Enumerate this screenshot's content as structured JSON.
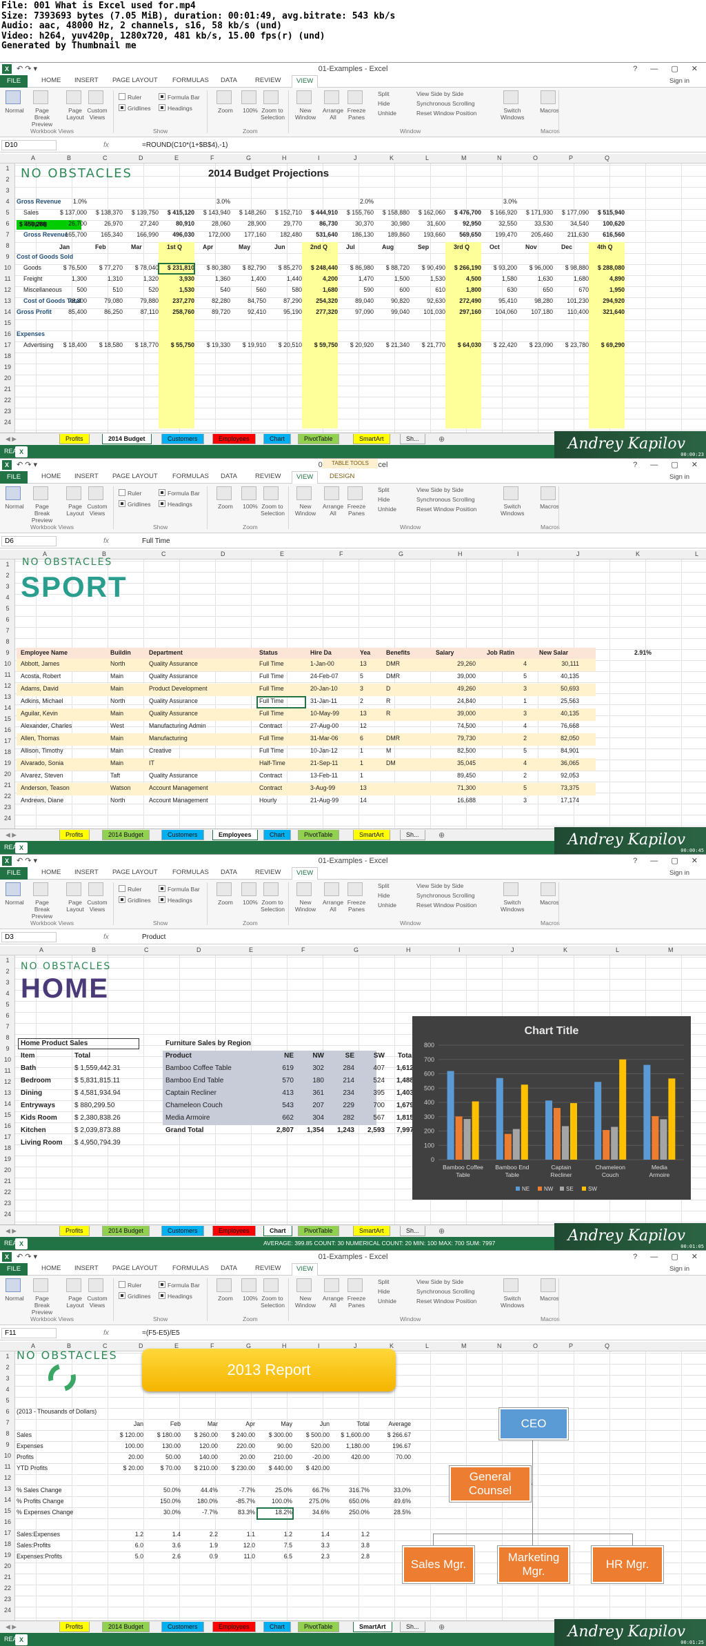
{
  "info": {
    "file": "File: 001 What is Excel used for.mp4",
    "size": "Size: 7393693 bytes (7.05 MiB), duration: 00:01:49, avg.bitrate: 543 kb/s",
    "audio": "Audio: aac, 48000 Hz, 2 channels, s16, 58 kb/s (und)",
    "video": "Video: h264, yuv420p, 1280x720, 481 kb/s, 15.00 fps(r) (und)",
    "gen": "Generated by Thumbnail me"
  },
  "common": {
    "title": "01-Examples - Excel",
    "file_tab": "FILE",
    "tabs": [
      "HOME",
      "INSERT",
      "PAGE LAYOUT",
      "FORMULAS",
      "DATA",
      "REVIEW",
      "VIEW"
    ],
    "design_tab": "DESIGN",
    "table_tools": "TABLE TOOLS",
    "sign_in": "Sign in",
    "ribbon": {
      "normal": "Normal",
      "page_break": "Page Break Preview",
      "page_layout": "Page Layout",
      "custom_views": "Custom Views",
      "ruler": "Ruler",
      "formula_bar": "Formula Bar",
      "gridlines": "Gridlines",
      "headings": "Headings",
      "zoom": "Zoom",
      "hundred": "100%",
      "zoom_sel": "Zoom to Selection",
      "new_window": "New Window",
      "arrange_all": "Arrange All",
      "freeze": "Freeze Panes",
      "split": "Split",
      "hide": "Hide",
      "unhide": "Unhide",
      "side_by_side": "View Side by Side",
      "sync_scroll": "Synchronous Scrolling",
      "reset_pos": "Reset Window Position",
      "switch": "Switch Windows",
      "macros": "Macros",
      "g_views": "Workbook Views",
      "g_show": "Show",
      "g_zoom": "Zoom",
      "g_window": "Window",
      "g_macros": "Macros"
    },
    "fx": "fx",
    "ready": "READY",
    "sheets": [
      "Profits",
      "2014 Budget",
      "Customers",
      "Employees",
      "Chart",
      "PivotTable",
      "SmartArt",
      "Sh..."
    ],
    "sheet_colors": [
      "#ffff00",
      "#92d050",
      "#00b0f0",
      "#ff0000",
      "#00b0f0",
      "#92d050",
      "#ffff00",
      "#f0f0f0"
    ],
    "brand": "Andrey Kapilov",
    "cols": [
      "A",
      "B",
      "C",
      "D",
      "E",
      "F",
      "G",
      "H",
      "I",
      "J",
      "K",
      "L",
      "M",
      "N",
      "O",
      "P",
      "Q"
    ]
  },
  "f1": {
    "namebox": "D10",
    "formula": "=ROUND(C10*(1+$B$4),-1)",
    "ts": "00:00:23",
    "logo": "NO OBSTACLES",
    "heading": "2014 Budget Projections",
    "cash": "$ 450,288",
    "months": [
      "Jan",
      "Feb",
      "Mar",
      "1st Q",
      "Apr",
      "May",
      "Jun",
      "2nd Q",
      "Jul",
      "Aug",
      "Sep",
      "3rd Q",
      "Oct",
      "Nov",
      "Dec",
      "4th Q"
    ],
    "rows": [
      {
        "r": "4",
        "label": "Gross Revenue",
        "vals": [
          "1.0%",
          "",
          "",
          "",
          "3.0%",
          "",
          "",
          "",
          "2.0%",
          "",
          "",
          "",
          "3.0%"
        ]
      },
      {
        "r": "5",
        "label": "Sales",
        "vals": [
          "$ 137,000",
          "$ 138,370",
          "$ 139,750",
          "$ 415,120",
          "$ 143,940",
          "$ 148,260",
          "$ 152,710",
          "$ 444,910",
          "$ 155,760",
          "$ 158,880",
          "$ 162,060",
          "$ 476,700",
          "$ 166,920",
          "$ 171,930",
          "$ 177,090",
          "$ 515,940"
        ]
      },
      {
        "r": "6",
        "label": "Shipping",
        "vals": [
          "26,700",
          "26,970",
          "27,240",
          "80,910",
          "28,060",
          "28,900",
          "29,770",
          "86,730",
          "30,370",
          "30,980",
          "31,600",
          "92,950",
          "32,550",
          "33,530",
          "34,540",
          "100,620"
        ]
      },
      {
        "r": "7",
        "label": "Gross Revenue",
        "vals": [
          "165,700",
          "165,340",
          "166,990",
          "496,030",
          "172,000",
          "177,160",
          "182,480",
          "531,640",
          "186,130",
          "189,860",
          "193,660",
          "569,650",
          "199,470",
          "205,460",
          "211,630",
          "616,560"
        ]
      },
      {
        "r": "9",
        "label": "Cost of Goods Sold",
        "vals": []
      },
      {
        "r": "10",
        "label": "Goods",
        "vals": [
          "$ 76,500",
          "$ 77,270",
          "$ 78,040",
          "$ 231,810",
          "$ 80,380",
          "$ 82,790",
          "$ 85,270",
          "$ 248,440",
          "$ 86,980",
          "$ 88,720",
          "$ 90,490",
          "$ 266,190",
          "$ 93,200",
          "$ 96,000",
          "$ 98,880",
          "$ 288,080"
        ]
      },
      {
        "r": "11",
        "label": "Freight",
        "vals": [
          "1,300",
          "1,310",
          "1,320",
          "3,930",
          "1,360",
          "1,400",
          "1,440",
          "4,200",
          "1,470",
          "1,500",
          "1,530",
          "4,500",
          "1,580",
          "1,630",
          "1,680",
          "4,890"
        ]
      },
      {
        "r": "12",
        "label": "Miscellaneous",
        "vals": [
          "500",
          "510",
          "520",
          "1,530",
          "540",
          "560",
          "580",
          "1,680",
          "590",
          "600",
          "610",
          "1,800",
          "630",
          "650",
          "670",
          "1,950"
        ]
      },
      {
        "r": "13",
        "label": "Cost of Goods Total",
        "vals": [
          "78,300",
          "79,080",
          "79,880",
          "237,270",
          "82,280",
          "84,750",
          "87,290",
          "254,320",
          "89,040",
          "90,820",
          "92,630",
          "272,490",
          "95,410",
          "98,280",
          "101,230",
          "294,920"
        ]
      },
      {
        "r": "14",
        "label": "Gross Profit",
        "vals": [
          "85,400",
          "86,250",
          "87,110",
          "258,760",
          "89,720",
          "92,410",
          "95,190",
          "277,320",
          "97,090",
          "99,040",
          "101,030",
          "297,160",
          "104,060",
          "107,180",
          "110,400",
          "321,640"
        ]
      },
      {
        "r": "16",
        "label": "Expenses",
        "vals": []
      },
      {
        "r": "17",
        "label": "Advertising",
        "vals": [
          "$ 18,400",
          "$ 18,580",
          "$ 18,770",
          "$ 55,750",
          "$ 19,330",
          "$ 19,910",
          "$ 20,510",
          "$ 59,750",
          "$ 20,920",
          "$ 21,340",
          "$ 21,770",
          "$ 64,030",
          "$ 22,420",
          "$ 23,090",
          "$ 23,780",
          "$ 69,290"
        ]
      }
    ]
  },
  "f2": {
    "namebox": "D6",
    "formula": "Full Time",
    "ts": "00:00:45",
    "logo_top": "NO OBSTACLES",
    "logo": "SPORT",
    "pct": "2.91%",
    "headers": [
      "Employee Name",
      "Buildin",
      "Department",
      "Status",
      "Hire Da",
      "Yea",
      "Benefits",
      "Salary",
      "Job Ratin",
      "New Salar"
    ],
    "rows": [
      [
        "Abbott, James",
        "North",
        "Quality Assurance",
        "Full Time",
        "1-Jan-00",
        "13",
        "DMR",
        "29,260",
        "4",
        "30,111"
      ],
      [
        "Acosta, Robert",
        "Main",
        "Quality Assurance",
        "Full Time",
        "24-Feb-07",
        "5",
        "DMR",
        "39,000",
        "5",
        "40,135"
      ],
      [
        "Adams, David",
        "Main",
        "Product Development",
        "Full Time",
        "20-Jan-10",
        "3",
        "D",
        "49,260",
        "3",
        "50,693"
      ],
      [
        "Adkins, Michael",
        "North",
        "Quality Assurance",
        "Full Time",
        "31-Jan-11",
        "2",
        "R",
        "24,840",
        "1",
        "25,563"
      ],
      [
        "Aguilar, Kevin",
        "Main",
        "Quality Assurance",
        "Full Time",
        "10-May-99",
        "13",
        "R",
        "39,000",
        "3",
        "40,135"
      ],
      [
        "Alexander, Charles",
        "West",
        "Manufacturing Admin",
        "Contract",
        "27-Aug-00",
        "12",
        "",
        "74,500",
        "4",
        "76,668"
      ],
      [
        "Allen, Thomas",
        "Main",
        "Manufacturing",
        "Full Time",
        "31-Mar-06",
        "6",
        "DMR",
        "79,730",
        "2",
        "82,050"
      ],
      [
        "Allison, Timothy",
        "Main",
        "Creative",
        "Full Time",
        "10-Jan-12",
        "1",
        "M",
        "82,500",
        "5",
        "84,901"
      ],
      [
        "Alvarado, Sonia",
        "Main",
        "IT",
        "Half-Time",
        "21-Sep-11",
        "1",
        "DM",
        "35,045",
        "4",
        "36,065"
      ],
      [
        "Alvarez, Steven",
        "Taft",
        "Quality Assurance",
        "Contract",
        "13-Feb-11",
        "1",
        "",
        "89,450",
        "2",
        "92,053"
      ],
      [
        "Anderson, Teason",
        "Watson",
        "Account Management",
        "Contract",
        "3-Aug-99",
        "13",
        "",
        "71,300",
        "5",
        "73,375"
      ],
      [
        "Andrews, Diane",
        "North",
        "Account Management",
        "Hourly",
        "21-Aug-99",
        "14",
        "",
        "16,688",
        "3",
        "17,174"
      ]
    ]
  },
  "f3": {
    "namebox": "D3",
    "formula": "Product",
    "ts": "00:01:05",
    "logo_top": "NO OBSTACLES",
    "logo": "HOME",
    "left_title": "Home Product Sales",
    "left_hdr": [
      "Item",
      "Total"
    ],
    "left_rows": [
      [
        "Bath",
        "$ 1,559,442.31"
      ],
      [
        "Bedroom",
        "$ 5,831,815.11"
      ],
      [
        "Dining",
        "$ 4,581,934.94"
      ],
      [
        "Entryways",
        "$ 880,299.50"
      ],
      [
        "Kids Room",
        "$ 2,380,838.26"
      ],
      [
        "Kitchen",
        "$ 2,039,873.88"
      ],
      [
        "Living Room",
        "$ 4,950,794.39"
      ]
    ],
    "right_title": "Furniture Sales by Region",
    "right_hdr": [
      "Product",
      "NE",
      "NW",
      "SE",
      "SW",
      "Total"
    ],
    "right_rows": [
      [
        "Bamboo Coffee Table",
        "619",
        "302",
        "284",
        "407",
        "1,612"
      ],
      [
        "Bamboo End Table",
        "570",
        "180",
        "214",
        "524",
        "1,488"
      ],
      [
        "Captain Recliner",
        "413",
        "361",
        "234",
        "395",
        "1,403"
      ],
      [
        "Chameleon Couch",
        "543",
        "207",
        "229",
        "700",
        "1,679"
      ],
      [
        "Media Armoire",
        "662",
        "304",
        "282",
        "567",
        "1,815"
      ]
    ],
    "grand": [
      "Grand Total",
      "2,807",
      "1,354",
      "1,243",
      "2,593",
      "7,997"
    ],
    "status": "AVERAGE: 399.85    COUNT: 30    NUMERICAL COUNT: 20    MIN: 100    MAX: 700    SUM: 7997"
  },
  "chart_data": {
    "type": "bar",
    "title": "Chart Title",
    "categories": [
      "Bamboo Coffee Table",
      "Bamboo End Table",
      "Captain Recliner",
      "Chameleon Couch",
      "Media Armoire"
    ],
    "series": [
      {
        "name": "NE",
        "values": [
          619,
          570,
          413,
          543,
          662
        ],
        "color": "#5b9bd5"
      },
      {
        "name": "NW",
        "values": [
          302,
          180,
          361,
          207,
          304
        ],
        "color": "#ed7d31"
      },
      {
        "name": "SE",
        "values": [
          284,
          214,
          234,
          229,
          282
        ],
        "color": "#a5a5a5"
      },
      {
        "name": "SW",
        "values": [
          407,
          524,
          395,
          700,
          567
        ],
        "color": "#ffc000"
      }
    ],
    "yticks": [
      "0",
      "100",
      "200",
      "300",
      "400",
      "500",
      "600",
      "700",
      "800"
    ],
    "ylim": [
      0,
      800
    ],
    "legend": "bottom"
  },
  "f4": {
    "namebox": "F11",
    "formula": "=(F5-E5)/E5",
    "ts": "00:01:25",
    "logo_top": "NO OBSTACLES",
    "banner": "2013 Report",
    "subtitle": "(2013 - Thousands of Dollars)",
    "cols": [
      "Jan",
      "Feb",
      "Mar",
      "Apr",
      "May",
      "Jun",
      "Total",
      "Average"
    ],
    "rows": [
      {
        "r": "5",
        "label": "Sales",
        "vals": [
          "$ 120.00",
          "$ 180.00",
          "$ 260.00",
          "$ 240.00",
          "$ 300.00",
          "$ 500.00",
          "$ 1,600.00",
          "$ 266.67"
        ]
      },
      {
        "r": "6",
        "label": "Expenses",
        "vals": [
          "100.00",
          "130.00",
          "120.00",
          "220.00",
          "90.00",
          "520.00",
          "1,180.00",
          "196.67"
        ]
      },
      {
        "r": "7",
        "label": "Profits",
        "vals": [
          "20.00",
          "50.00",
          "140.00",
          "20.00",
          "210.00",
          "-20.00",
          "420.00",
          "70.00"
        ]
      },
      {
        "r": "8",
        "label": "YTD Profits",
        "vals": [
          "$ 20.00",
          "$ 70.00",
          "$ 210.00",
          "$ 230.00",
          "$ 440.00",
          "$ 420.00",
          "",
          ""
        ]
      },
      {
        "r": "10",
        "label": "% Sales Change",
        "vals": [
          "",
          "50.0%",
          "44.4%",
          "-7.7%",
          "25.0%",
          "66.7%",
          "316.7%",
          "33.0%"
        ]
      },
      {
        "r": "11",
        "label": "% Profits Change",
        "vals": [
          "",
          "150.0%",
          "180.0%",
          "-85.7%",
          "100.0%",
          "275.0%",
          "650.0%",
          "49.6%"
        ]
      },
      {
        "r": "12",
        "label": "% Expenses Change",
        "vals": [
          "",
          "30.0%",
          "-7.7%",
          "83.3%",
          "18.2%",
          "34.6%",
          "250.0%",
          "28.5%"
        ]
      },
      {
        "r": "14",
        "label": "Sales:Expenses",
        "vals": [
          "1.2",
          "1.4",
          "2.2",
          "1.1",
          "1.2",
          "1.4",
          "1.2",
          ""
        ]
      },
      {
        "r": "15",
        "label": "Sales:Profits",
        "vals": [
          "6.0",
          "3.6",
          "1.9",
          "12.0",
          "7.5",
          "3.3",
          "3.8",
          ""
        ]
      },
      {
        "r": "16",
        "label": "Expenses:Profits",
        "vals": [
          "5.0",
          "2.6",
          "0.9",
          "11.0",
          "6.5",
          "2.3",
          "2.8",
          ""
        ]
      }
    ],
    "org": {
      "ceo": "CEO",
      "counsel": "General Counsel",
      "sales": "Sales Mgr.",
      "marketing": "Marketing Mgr.",
      "hr": "HR Mgr."
    }
  }
}
